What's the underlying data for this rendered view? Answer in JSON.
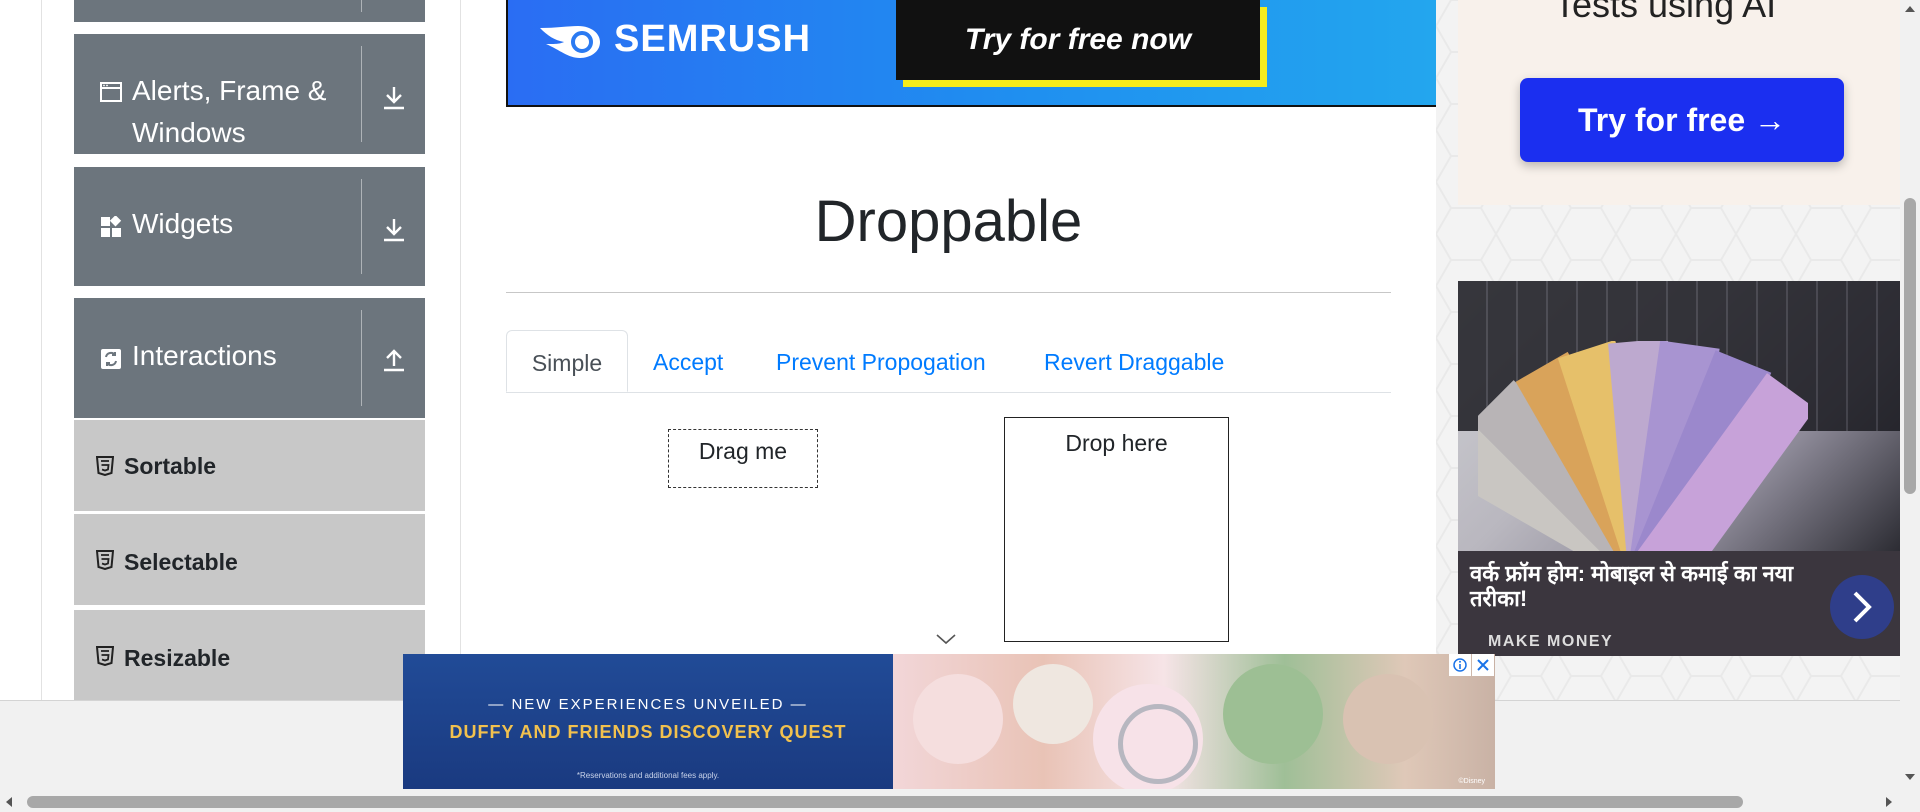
{
  "sidebar": {
    "groups": [
      {
        "label": "Alerts, Frame &",
        "label2": "Windows",
        "icon": "window-icon",
        "toggle": "expand-icon"
      },
      {
        "label": "Widgets",
        "icon": "widgets-icon",
        "toggle": "expand-icon"
      },
      {
        "label": "Interactions",
        "icon": "interactions-icon",
        "toggle": "collapse-icon"
      }
    ],
    "items": [
      {
        "label": "Sortable"
      },
      {
        "label": "Selectable"
      },
      {
        "label": "Resizable"
      }
    ]
  },
  "ads": {
    "semrush": {
      "brand": "SEMRUSH",
      "cta": "Try for free now"
    },
    "ai": {
      "title": "Tests using AI",
      "cta": "Try for free →"
    },
    "money": {
      "headline": "वर्क फ्रॉम होम: मोबाइल से कमाई का नया तरीका!",
      "category": "MAKE MONEY"
    },
    "disney": {
      "line1": "— NEW EXPERIENCES UNVEILED —",
      "line2": "DUFFY AND FRIENDS DISCOVERY QUEST",
      "fine": "*Reservations and additional fees apply.",
      "mark": "©Disney"
    }
  },
  "main": {
    "title": "Droppable",
    "tabs": [
      {
        "label": "Simple",
        "active": true
      },
      {
        "label": "Accept",
        "active": false
      },
      {
        "label": "Prevent Propogation",
        "active": false
      },
      {
        "label": "Revert Draggable",
        "active": false
      }
    ],
    "draggable": "Drag me",
    "droppable": "Drop here"
  },
  "colors": {
    "sidebar_group": "#6c757d",
    "sidebar_item": "#c8c8c8",
    "link": "#007bff",
    "semrush_cta_shadow": "#f6ec1c",
    "ai_button": "#1b2ff0"
  }
}
